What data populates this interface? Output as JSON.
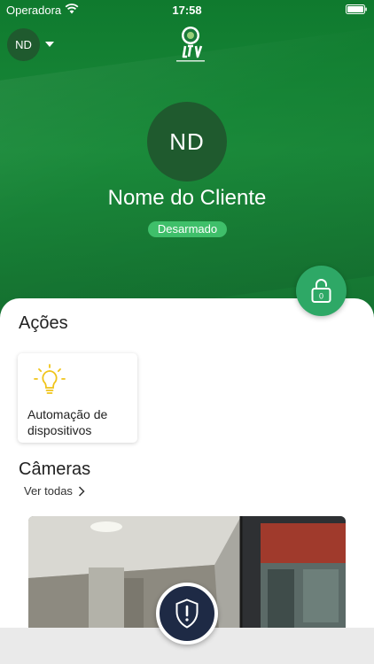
{
  "status_bar": {
    "carrier": "Operadora",
    "time": "17:58"
  },
  "header": {
    "user_initials": "ND"
  },
  "profile": {
    "initials": "ND",
    "name": "Nome do Cliente",
    "alarm_status": "Desarmado"
  },
  "lock_button": {
    "icon": "lock-icon",
    "zone_label": "0"
  },
  "actions": {
    "title": "Ações",
    "items": [
      {
        "label": "Automação de dispositivos",
        "icon": "lightbulb-icon"
      }
    ]
  },
  "cameras": {
    "title": "Câmeras",
    "see_all": "Ver todas"
  },
  "panic_button": {
    "icon": "shield-alert-icon"
  },
  "colors": {
    "primary_green": "#1a8a3a",
    "accent_green": "#2ea866",
    "badge_green": "#3fbf6a",
    "avatar_dark": "#1f5a2e",
    "panic_navy": "#1e2a45",
    "bulb_yellow": "#f0c419"
  }
}
